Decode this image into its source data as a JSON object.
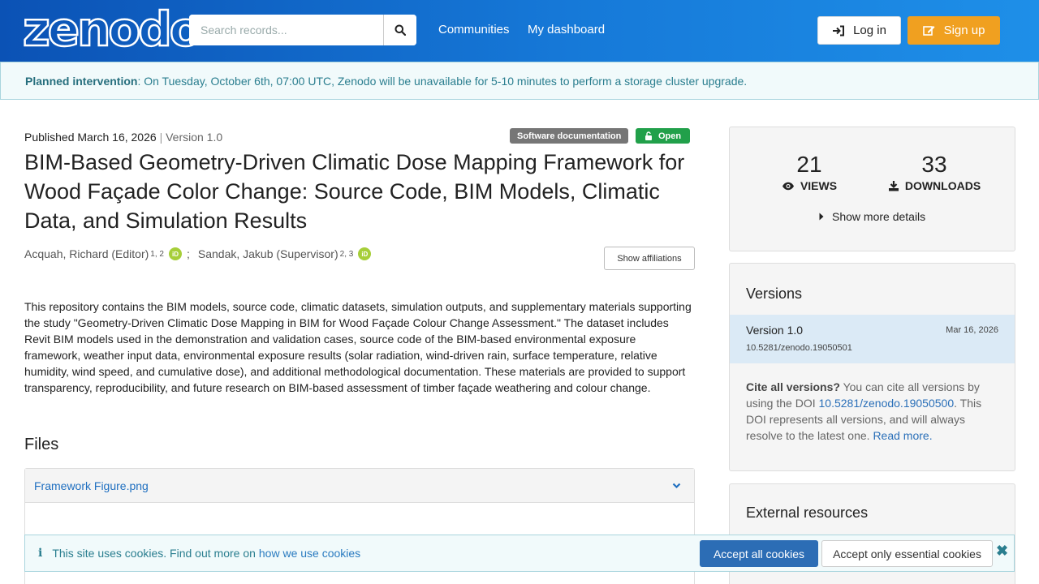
{
  "header": {
    "logo": "zenodo",
    "search_placeholder": "Search records...",
    "nav": [
      "Communities",
      "My dashboard"
    ],
    "login_label": "Log in",
    "signup_label": "Sign up"
  },
  "banner": {
    "strong": "Planned intervention",
    "text": ": On Tuesday, October 6th, 07:00 UTC, Zenodo will be unavailable for 5-10 minutes to perform a storage cluster upgrade."
  },
  "record": {
    "published": "Published March 16, 2026",
    "separator": "|",
    "version": "Version 1.0",
    "resource_type": "Software documentation",
    "access": "Open",
    "title": "BIM-Based Geometry-Driven Climatic Dose Mapping Framework for Wood Façade Color Change: Source Code, BIM Models, Climatic Data, and Simulation Results",
    "authors": [
      {
        "name": "Acquah, Richard (Editor)",
        "affil": "1, 2"
      },
      {
        "name": "Sandak, Jakub (Supervisor)",
        "affil": "2, 3"
      }
    ],
    "author_separator": ";",
    "orcid_label": "iD",
    "show_affiliations": "Show affiliations",
    "description": "This repository contains the BIM models, source code, climatic datasets, simulation outputs, and supplementary materials supporting the study \"Geometry-Driven Climatic Dose Mapping in BIM for Wood Façade Colour Change Assessment.\" The dataset includes Revit BIM models used in the demonstration and validation cases, source code of the BIM-based environmental exposure framework, weather input data, environmental exposure results (solar radiation, wind-driven rain, surface temperature, relative humidity, wind speed, and cumulative dose), and additional methodological documentation. These materials are provided to support transparency, reproducibility, and future research on BIM-based assessment of timber façade weathering and colour change.",
    "files_heading": "Files",
    "files": [
      {
        "name": "Framework Figure.png"
      }
    ]
  },
  "sidebar": {
    "views": {
      "count": "21",
      "label": "VIEWS"
    },
    "downloads": {
      "count": "33",
      "label": "DOWNLOADS"
    },
    "more_details": "Show more details",
    "versions_heading": "Versions",
    "current_version": {
      "label": "Version 1.0",
      "date": "Mar 16, 2026",
      "doi": "10.5281/zenodo.19050501"
    },
    "cite": {
      "strong": "Cite all versions?",
      "pre": " You can cite all versions by using the DOI ",
      "doi": "10.5281/zenodo.19050500",
      "post": ". This DOI represents all versions, and will always resolve to the latest one. ",
      "read_more": "Read more."
    },
    "external_heading": "External resources"
  },
  "cookies": {
    "icon": "i",
    "text": "This site uses cookies. Find out more on",
    "link": "how we use cookies",
    "accept_all": "Accept all cookies",
    "accept_essential": "Accept only essential cookies",
    "close": "✖"
  }
}
